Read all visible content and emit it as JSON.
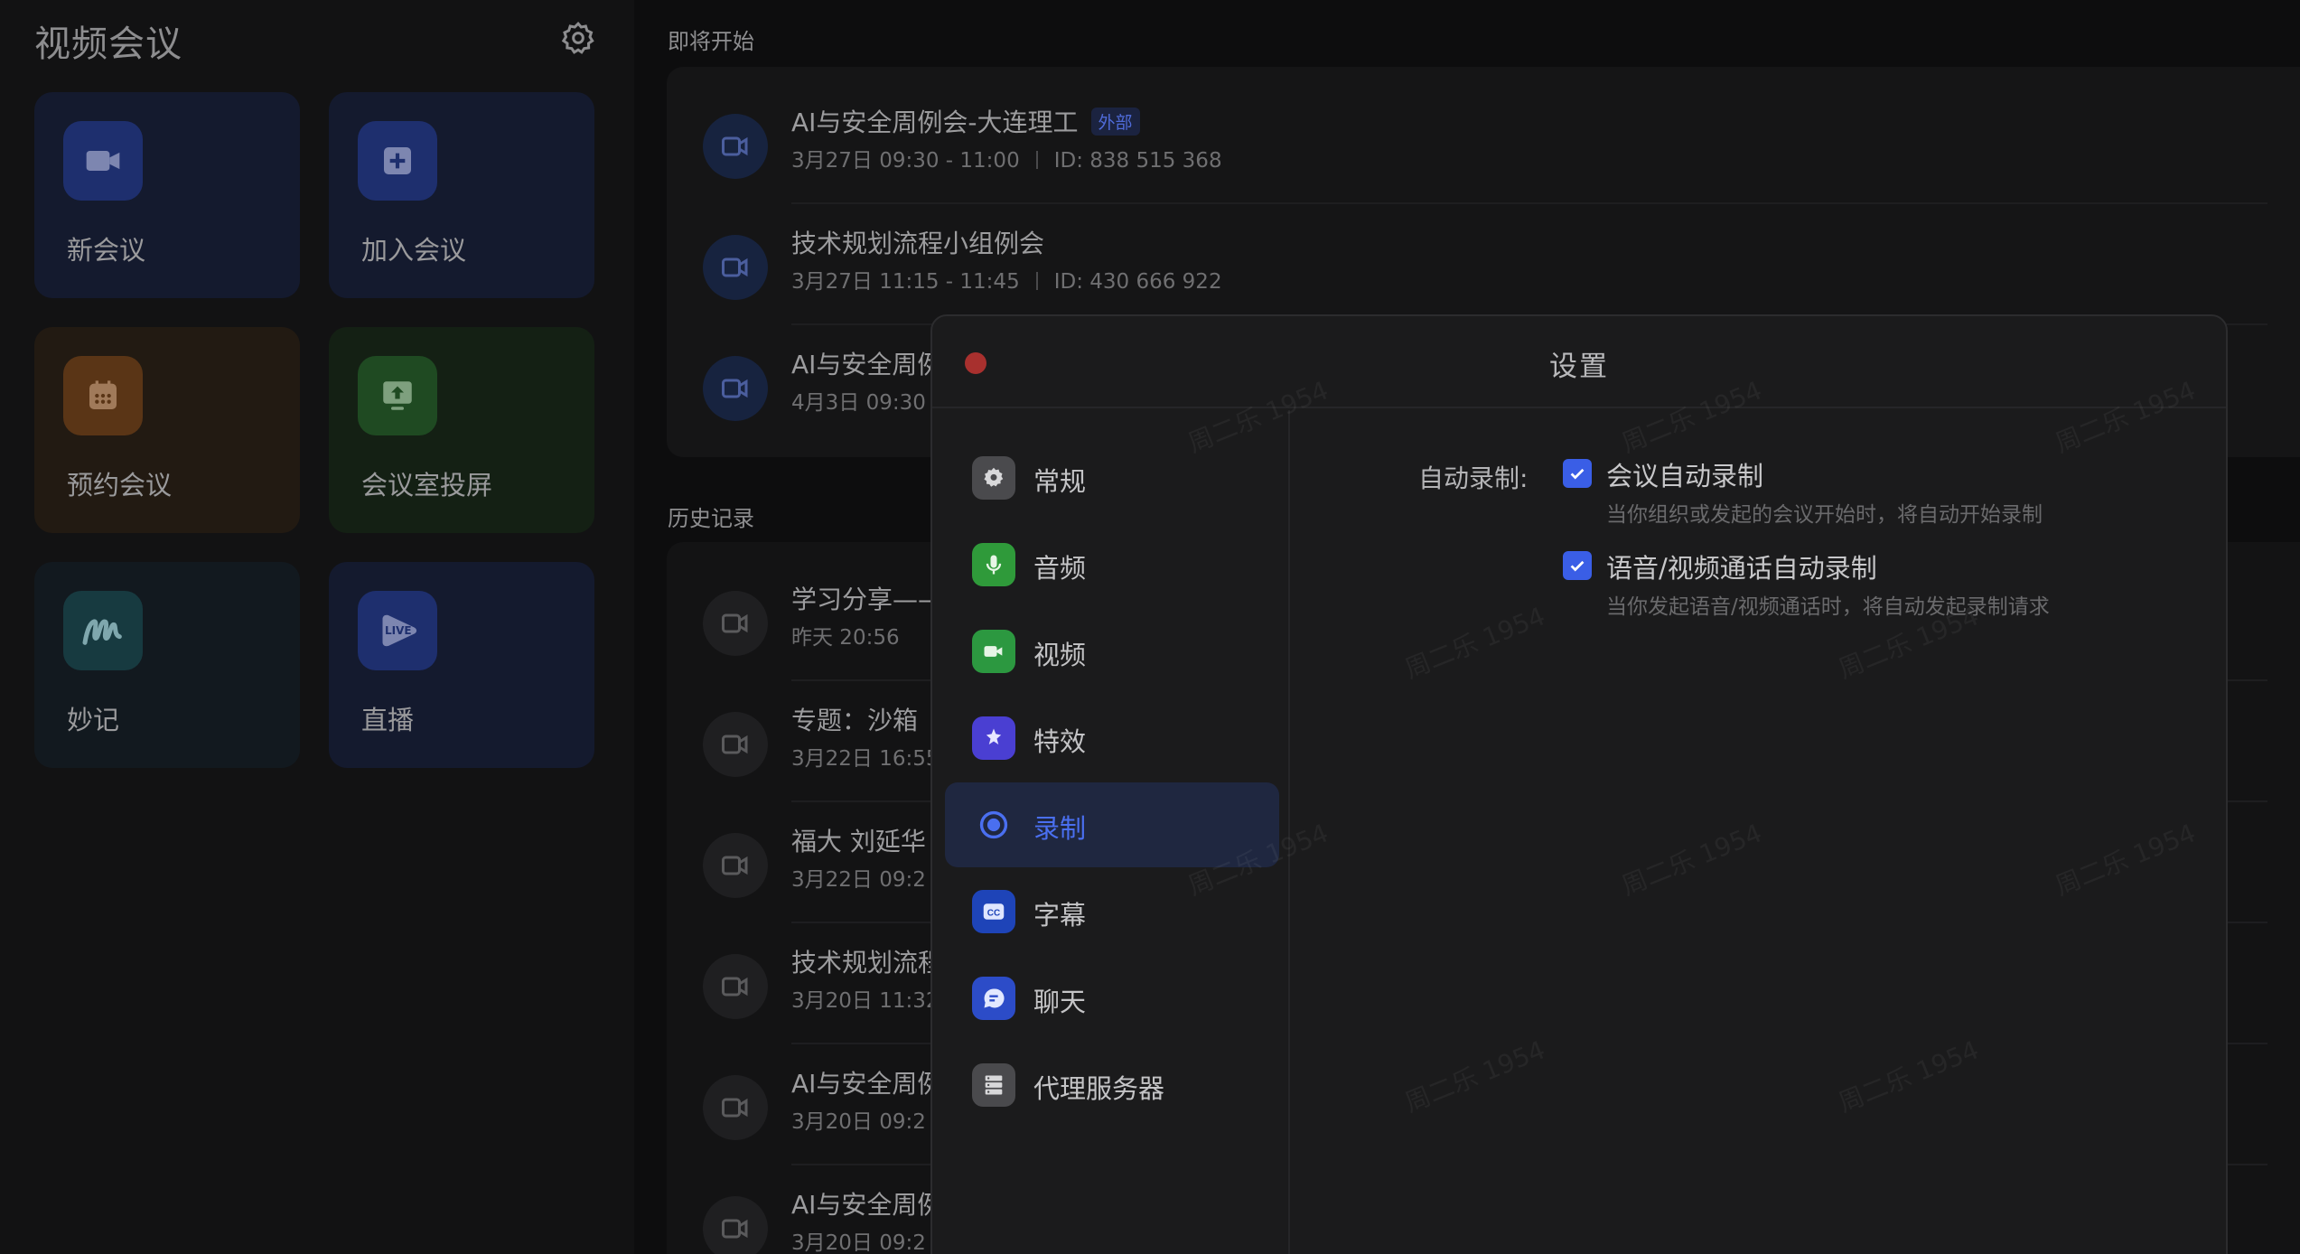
{
  "sidebar": {
    "title": "视频会议",
    "tiles": {
      "new_meeting": "新会议",
      "join_meeting": "加入会议",
      "schedule_meeting": "预约会议",
      "room_cast": "会议室投屏",
      "minutes": "妙记",
      "live": "直播"
    },
    "live_badge": "LIVE"
  },
  "upcoming": {
    "title": "即将开始",
    "items": [
      {
        "title": "AI与安全周例会-大连理工",
        "tag": "外部",
        "time": "3月27日 09:30 - 11:00",
        "id": "ID: 838 515 368"
      },
      {
        "title": "技术规划流程小组例会",
        "time": "3月27日 11:15 - 11:45",
        "id": "ID: 430 666 922"
      },
      {
        "title": "AI与安全周例",
        "time": "4月3日 09:30"
      }
    ]
  },
  "history": {
    "title": "历史记录",
    "items": [
      {
        "title": "学习分享——",
        "time": "昨天 20:56"
      },
      {
        "title": "专题：沙箱",
        "time": "3月22日 16:55"
      },
      {
        "title": "福大 刘延华",
        "time": "3月22日 09:2"
      },
      {
        "title": "技术规划流程",
        "time": "3月20日 11:32"
      },
      {
        "title": "AI与安全周例",
        "time": "3月20日 09:2"
      },
      {
        "title": "AI与安全周例",
        "time": "3月20日 09:2"
      }
    ]
  },
  "settings": {
    "title": "设置",
    "nav": {
      "general": "常规",
      "audio": "音频",
      "video": "视频",
      "effects": "特效",
      "recording": "录制",
      "subtitles": "字幕",
      "chat": "聊天",
      "proxy": "代理服务器"
    },
    "recording": {
      "label": "自动录制:",
      "option1_title": "会议自动录制",
      "option1_desc": "当你组织或发起的会议开始时，将自动开始录制",
      "option2_title": "语音/视频通话自动录制",
      "option2_desc": "当你发起语音/视频通话时，将自动发起录制请求"
    }
  },
  "watermark": "周二乐 1954",
  "colors": {
    "accent": "#3a5ee6",
    "close": "#a8302e"
  }
}
